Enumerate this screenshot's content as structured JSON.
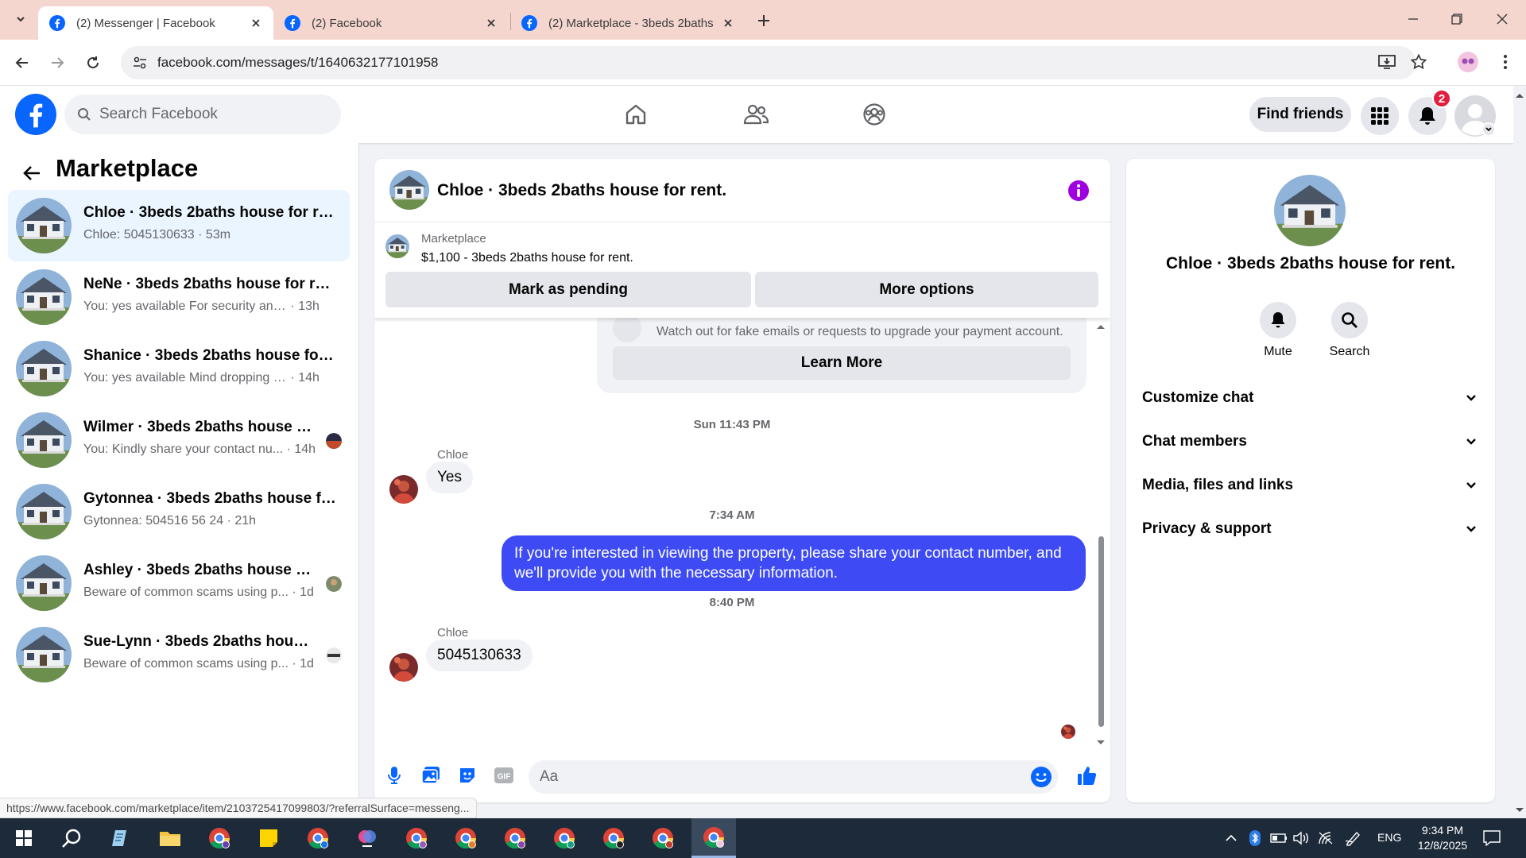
{
  "browser": {
    "tabs": [
      {
        "title": "(2) Messenger | Facebook",
        "active": true
      },
      {
        "title": "(2) Facebook",
        "active": false
      },
      {
        "title": "(2) Marketplace - 3beds 2baths",
        "active": false
      }
    ],
    "url": "facebook.com/messages/t/1640632177101958",
    "status_url": "https://www.facebook.com/marketplace/item/2103725417099803/?referralSurface=messeng..."
  },
  "header": {
    "search_placeholder": "Search Facebook",
    "find_friends": "Find friends",
    "notification_count": "2"
  },
  "sidebar": {
    "title": "Marketplace",
    "conversations": [
      {
        "name": "Chloe · 3beds 2baths house for rent.",
        "preview": "Chloe: 5045130633",
        "time": "· 53m",
        "selected": true
      },
      {
        "name": "NeNe · 3beds 2baths house for rent.",
        "preview": "You: yes available For security and ve...",
        "time": "· 13h"
      },
      {
        "name": "Shanice · 3beds 2baths house for r...",
        "preview": "You: yes available Mind dropping yo...",
        "time": "· 14h"
      },
      {
        "name": "Wilmer · 3beds 2baths house fo...",
        "preview": "You: Kindly share your contact nu...",
        "time": "· 14h"
      },
      {
        "name": "Gytonnea · 3beds 2baths house fo...",
        "preview": "Gytonnea: 504516 56 24",
        "time": "· 21h"
      },
      {
        "name": "Ashley · 3beds 2baths house for...",
        "preview": "Beware of common scams using p...",
        "time": "· 1d"
      },
      {
        "name": "Sue-Lynn · 3beds 2baths house f...",
        "preview": "Beware of common scams using p...",
        "time": "· 1d"
      }
    ]
  },
  "chat": {
    "title": "Chloe · 3beds 2baths house for rent.",
    "listing_kicker": "Marketplace",
    "listing_title": "$1,100 - 3beds 2baths house for rent.",
    "mark_pending": "Mark as pending",
    "more_options": "More options",
    "scam_notice": "Watch out for fake emails or requests to upgrade your payment account.",
    "learn_more": "Learn More",
    "messages": [
      {
        "timestamp": "Sun 11:43 PM"
      },
      {
        "sender": "Chloe",
        "text": "Yes"
      },
      {
        "timestamp": "7:34 AM"
      },
      {
        "sender": "You",
        "text": "If you're interested in viewing the property, please share your contact number, and we'll provide you with the necessary information."
      },
      {
        "timestamp": "8:40 PM"
      },
      {
        "sender": "Chloe",
        "text": "5045130633"
      }
    ],
    "composer_placeholder": "Aa"
  },
  "info_panel": {
    "title": "Chloe · 3beds 2baths house for rent.",
    "actions": [
      {
        "label": "Mute",
        "icon": "bell-icon"
      },
      {
        "label": "Search",
        "icon": "search-icon"
      }
    ],
    "sections": [
      "Customize chat",
      "Chat members",
      "Media, files and links",
      "Privacy & support"
    ]
  },
  "taskbar": {
    "language": "ENG",
    "time": "9:34 PM",
    "date": "12/8/2025"
  },
  "colors": {
    "facebook_blue": "#0866ff",
    "outgoing_bubble": "#3e4bf4",
    "info_purple": "#a000e0",
    "badge_red": "#e41e3f",
    "selected_row": "#ebf5ff",
    "tabbar": "#f5d6cf"
  }
}
